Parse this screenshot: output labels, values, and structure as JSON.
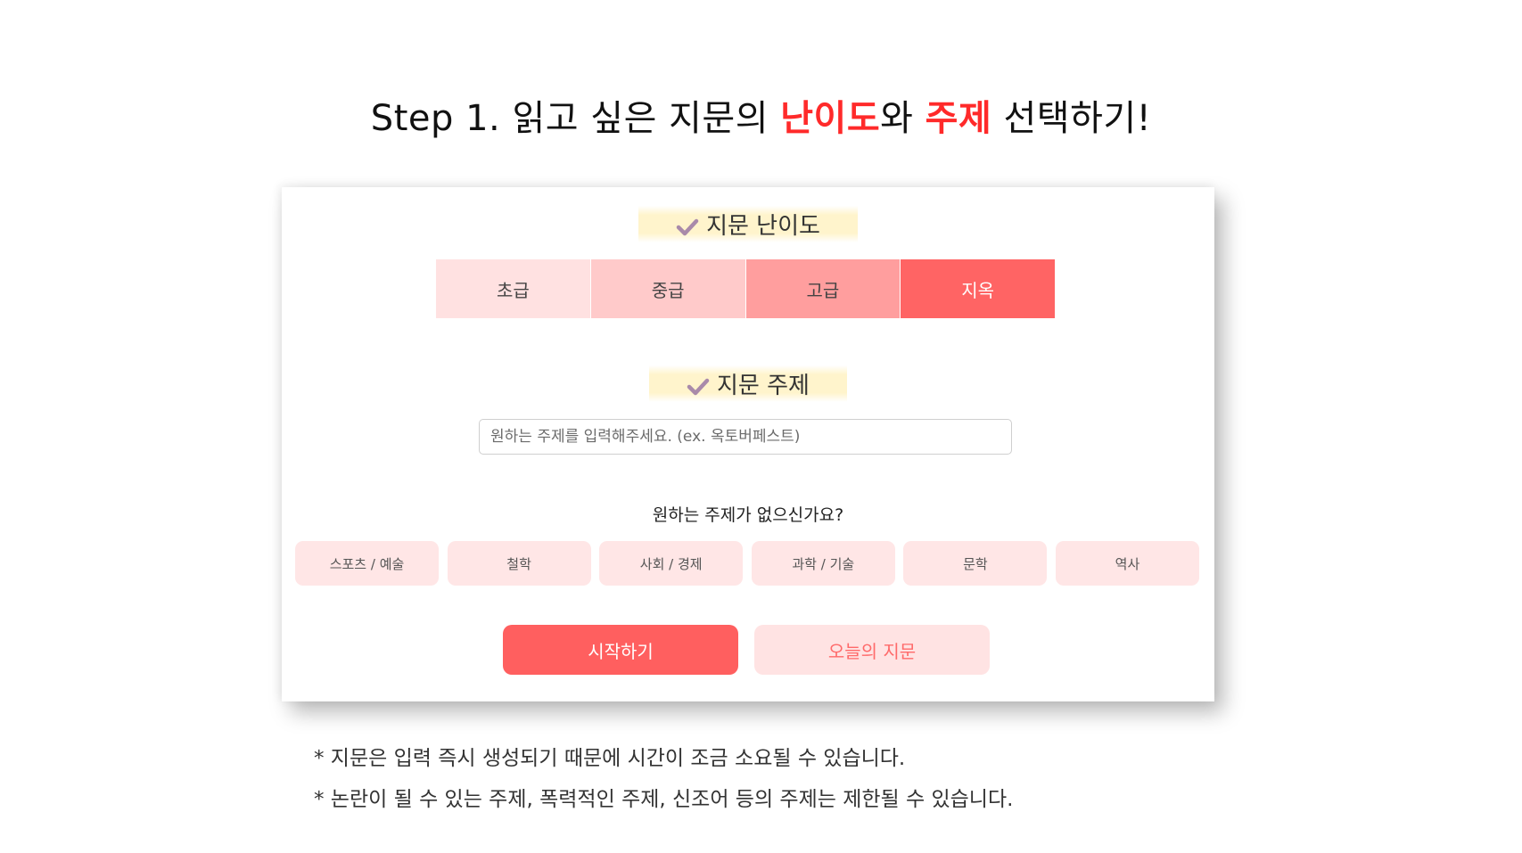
{
  "headline": {
    "part1": "Step 1. 읽고 싶은 지문의 ",
    "highlight1": "난이도",
    "part2": "와 ",
    "highlight2": "주제",
    "part3": " 선택하기!"
  },
  "difficulty": {
    "title": "지문 난이도",
    "options": [
      {
        "label": "초급",
        "color": "#ffe1e1"
      },
      {
        "label": "중급",
        "color": "#ffcaca"
      },
      {
        "label": "고급",
        "color": "#ff9e9e"
      },
      {
        "label": "지옥",
        "color": "#ff6464"
      }
    ]
  },
  "topic": {
    "title": "지문 주제",
    "placeholder": "원하는 주제를 입력해주세요. (ex. 옥토버페스트)",
    "question": "원하는 주제가 없으신가요?",
    "chips": [
      "스포츠 / 예술",
      "철학",
      "사회 / 경제",
      "과학 / 기술",
      "문학",
      "역사"
    ]
  },
  "buttons": {
    "start": "시작하기",
    "today": "오늘의 지문"
  },
  "notes": [
    "* 지문은 입력 즉시 생성되기 때문에 시간이 조금 소요될 수 있습니다.",
    "* 논란이 될 수 있는 주제, 폭력적인 주제, 신조어 등의 주제는 제한될 수 있습니다."
  ],
  "colors": {
    "accent": "#ff5f5f",
    "headline_highlight": "#ff2a2a",
    "check": "#a98aaa",
    "title_highlight": "#fff4cc",
    "chip_bg": "#ffe6e6"
  },
  "icons": {
    "section_check": "check-icon"
  }
}
